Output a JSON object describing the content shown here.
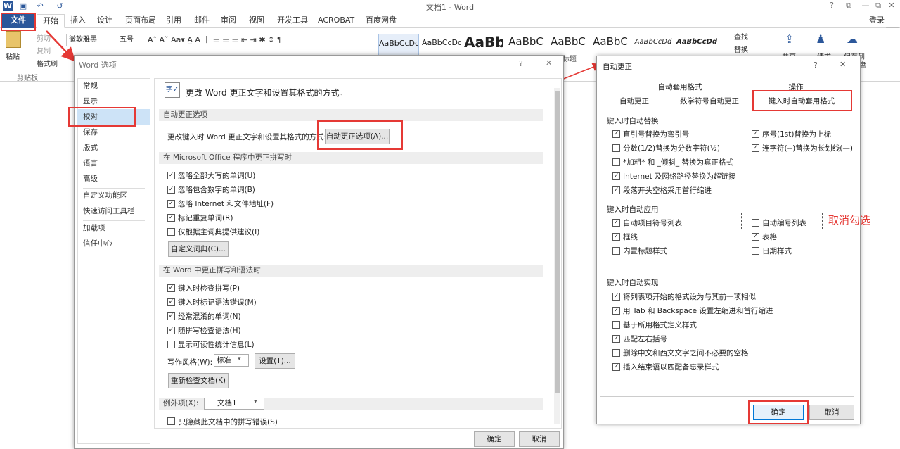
{
  "window": {
    "doc_title": "文档1 - Word",
    "controls": [
      "?",
      "⧉",
      "—",
      "⧉",
      "✕"
    ],
    "login": "登录"
  },
  "tabs": {
    "file": "文件",
    "items": [
      "开始",
      "插入",
      "设计",
      "页面布局",
      "引用",
      "邮件",
      "审阅",
      "视图",
      "开发工具",
      "ACROBAT",
      "百度网盘"
    ]
  },
  "ribbon": {
    "clipboard": {
      "paste": "粘贴",
      "cut": "剪切",
      "copy": "复制",
      "format_painter": "格式刷",
      "group": "剪贴板"
    },
    "font": {
      "name": "微软雅黑",
      "size": "五号"
    },
    "styles": [
      "AaBbCcDd",
      "AaBbCcDd",
      "AaBb",
      "AaBbC",
      "AaBbC",
      "AaBbC",
      "AaBbCcDd",
      "AaBbCcDd"
    ],
    "edit": {
      "find": "查找",
      "replace": "替换"
    },
    "share": "共享",
    "bd1": "请求",
    "bd2": "保存到",
    "bd3": "盘",
    "tag": "标题"
  },
  "options_dialog": {
    "title": "Word 选项",
    "help": "?",
    "close": "✕",
    "sidebar": [
      "常规",
      "显示",
      "校对",
      "保存",
      "版式",
      "语言",
      "高级",
      "自定义功能区",
      "快速访问工具栏",
      "加载项",
      "信任中心"
    ],
    "header": "更改 Word 更正文字和设置其格式的方式。",
    "sec1": "自动更正选项",
    "sec1_label": "更改键入时 Word 更正文字和设置其格式的方式:",
    "sec1_btn": "自动更正选项(A)...",
    "sec2": "在 Microsoft Office 程序中更正拼写时",
    "sec2_items": [
      "忽略全部大写的单词(U)",
      "忽略包含数字的单词(B)",
      "忽略 Internet 和文件地址(F)",
      "标记重复单词(R)",
      "仅根据主词典提供建议(I)"
    ],
    "sec2_checked": [
      true,
      true,
      true,
      true,
      false
    ],
    "dict_btn": "自定义词典(C)...",
    "sec3": "在 Word 中更正拼写和语法时",
    "sec3_items": [
      "键入时检查拼写(P)",
      "键入时标记语法错误(M)",
      "经常混淆的单词(N)",
      "随拼写检查语法(H)",
      "显示可读性统计信息(L)"
    ],
    "sec3_checked": [
      true,
      true,
      true,
      true,
      false
    ],
    "style_label": "写作风格(W):",
    "style_value": "标准",
    "settings_btn": "设置(T)...",
    "recheck_btn": "重新检查文档(K)",
    "sec4": "例外项(X):",
    "sec4_doc": "文档1",
    "sec4_item": "只隐藏此文档中的拼写错误(S)",
    "ok": "确定",
    "cancel": "取消"
  },
  "autocorrect_dialog": {
    "title": "自动更正",
    "help": "?",
    "close": "✕",
    "tabs_top": [
      "自动套用格式",
      "操作"
    ],
    "tabs_bottom": [
      "自动更正",
      "数学符号自动更正",
      "键入时自动套用格式"
    ],
    "g1": "键入时自动替换",
    "g1_left": [
      "直引号替换为弯引号",
      "分数(1/2)替换为分数字符(½)",
      "*加粗* 和 _倾斜_ 替换为真正格式",
      "Internet 及网络路径替换为超链接",
      "段落开头空格采用首行缩进"
    ],
    "g1_left_checked": [
      true,
      false,
      false,
      true,
      true
    ],
    "g1_right": [
      "序号(1st)替换为上标",
      "连字符(--)替换为长划线(—)"
    ],
    "g1_right_checked": [
      true,
      true
    ],
    "g2": "键入时自动应用",
    "g2_left": [
      "自动项目符号列表",
      "框线",
      "内置标题样式"
    ],
    "g2_left_checked": [
      true,
      true,
      false
    ],
    "g2_right": [
      "自动编号列表",
      "表格",
      "日期样式"
    ],
    "g2_right_checked": [
      false,
      true,
      false
    ],
    "g3": "键入时自动实现",
    "g3_items": [
      "将列表项开始的格式设为与其前一项相似",
      "用 Tab 和 Backspace 设置左缩进和首行缩进",
      "基于所用格式定义样式",
      "匹配左右括号",
      "删除中文和西文文字之间不必要的空格",
      "插入结束语以匹配备忘录样式"
    ],
    "g3_checked": [
      true,
      true,
      false,
      true,
      false,
      true
    ],
    "ok": "确定",
    "cancel": "取消"
  },
  "annotation": "取消勾选",
  "colors": {
    "accent": "#2b579a",
    "annotation": "#e53935",
    "selected": "#cde3f7"
  }
}
